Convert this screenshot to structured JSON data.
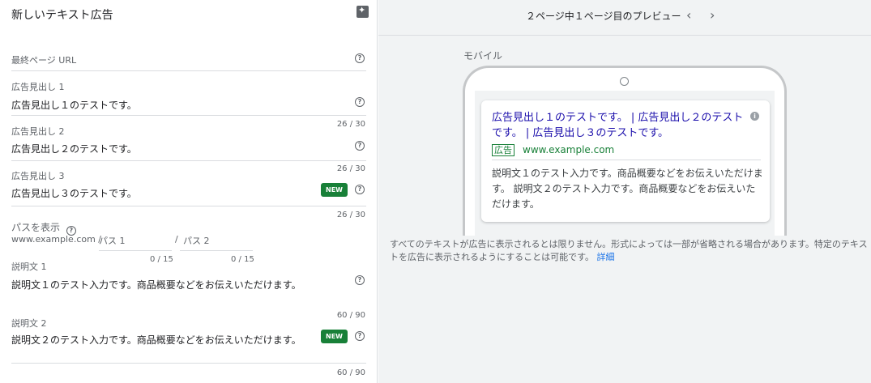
{
  "left": {
    "title": "新しいテキスト広告",
    "final_url": {
      "label": "最終ページ URL"
    },
    "headline1": {
      "label": "広告見出し 1",
      "value": "広告見出し１のテストです。",
      "count": "26 / 30"
    },
    "headline2": {
      "label": "広告見出し 2",
      "value": "広告見出し２のテストです。",
      "count": "26 / 30"
    },
    "headline3": {
      "label": "広告見出し 3",
      "value": "広告見出し３のテストです。",
      "count": "26 / 30",
      "badge": "NEW"
    },
    "path": {
      "label": "パスを表示",
      "domain": "www.example.com /",
      "path1_placeholder": "パス 1",
      "path2_prefix": "/",
      "path2_placeholder": "パス 2",
      "path1_count": "0 / 15",
      "path2_count": "0 / 15"
    },
    "description1": {
      "label": "説明文 1",
      "value": "説明文１のテスト入力です。商品概要などをお伝えいただけます。",
      "count": "60 / 90"
    },
    "description2": {
      "label": "説明文 2",
      "value": "説明文２のテスト入力です。商品概要などをお伝えいただけます。",
      "count": "60 / 90",
      "badge": "NEW"
    }
  },
  "preview": {
    "page_info": "２ページ中１ページ目のプレビュー",
    "prev_icon": "chevron-left-icon",
    "next_icon": "chevron-right-icon",
    "device_label": "モバイル",
    "ad": {
      "title": "広告見出し１のテストです。 | 広告見出し２のテストです。 | 広告見出し３のテストです。",
      "badge": "広告",
      "url": "www.example.com",
      "description": "説明文１のテスト入力です。商品概要などをお伝えいただけます。 説明文２のテスト入力です。商品概要などをお伝えいただけます。"
    },
    "notice": "すべてのテキストが広告に表示されるとは限りません。形式によっては一部が省略される場合があります。特定のテキストを広告に表示されるようにすることは可能です。",
    "notice_link": "詳細"
  },
  "colors": {
    "link_blue": "#1a0dab",
    "url_green": "#188038",
    "new_badge": "#188038",
    "accent_blue": "#1a73e8"
  }
}
